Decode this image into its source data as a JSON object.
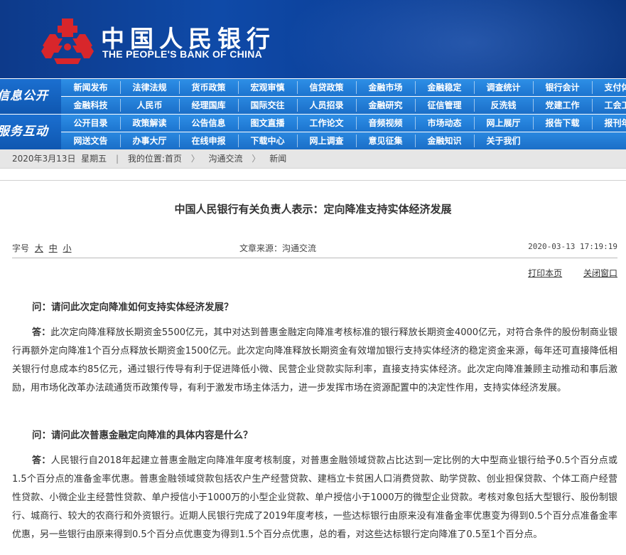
{
  "header": {
    "logo_cn": "中国人民银行",
    "logo_en": "THE PEOPLE'S BANK OF CHINA",
    "brand_color": "#0f4aa8",
    "logo_color": "#d8262b"
  },
  "nav": {
    "group1_tag": "信息公开",
    "group2_tag": "服务互动",
    "group1_row1": [
      "新闻发布",
      "法律法规",
      "货币政策",
      "宏观审慎",
      "信贷政策",
      "金融市场",
      "金融稳定",
      "调查统计",
      "银行会计",
      "支付体系"
    ],
    "group1_row2": [
      "金融科技",
      "人民币",
      "经理国库",
      "国际交往",
      "人员招录",
      "金融研究",
      "征信管理",
      "反洗钱",
      "党建工作",
      "工会工作"
    ],
    "group2_row1": [
      "公开目录",
      "政策解读",
      "公告信息",
      "图文直播",
      "工作论文",
      "音频视频",
      "市场动态",
      "网上展厅",
      "报告下载",
      "报刊年鉴"
    ],
    "group2_row2": [
      "网送文告",
      "办事大厅",
      "在线申报",
      "下载中心",
      "网上调查",
      "意见征集",
      "金融知识",
      "关于我们"
    ]
  },
  "breadcrumb": {
    "date": "2020年3月13日",
    "weekday": "星期五",
    "location_label": "我的位置:首页",
    "level2": "沟通交流",
    "level3": "新闻",
    "sep": "〉"
  },
  "article": {
    "title": "中国人民银行有关负责人表示：定向降准支持实体经济发展",
    "font_size_label": "字号",
    "font_large": "大",
    "font_medium": "中",
    "font_small": "小",
    "source": "文章来源：沟通交流",
    "datetime": "2020-03-13 17:19:19",
    "print_link": "打印本页",
    "close_link": "关闭窗口",
    "q1": "问：请问此次定向降准如何支持实体经济发展？",
    "a1_label": "答：",
    "a1": "此次定向降准释放长期资金5500亿元，其中对达到普惠金融定向降准考核标准的银行释放长期资金4000亿元，对符合条件的股份制商业银行再额外定向降准1个百分点释放长期资金1500亿元。此次定向降准释放长期资金有效增加银行支持实体经济的稳定资金来源，每年还可直接降低相关银行付息成本约85亿元，通过银行传导有利于促进降低小微、民营企业贷款实际利率，直接支持实体经济。此次定向降准兼顾主动推动和事后激励，用市场化改革办法疏通货币政策传导，有利于激发市场主体活力，进一步发挥市场在资源配置中的决定性作用，支持实体经济发展。",
    "q2": "问：请问此次普惠金融定向降准的具体内容是什么？",
    "a2_label": "答：",
    "a2": "人民银行自2018年起建立普惠金融定向降准年度考核制度，对普惠金融领域贷款占比达到一定比例的大中型商业银行给予0.5个百分点或1.5个百分点的准备金率优惠。普惠金融领域贷款包括农户生产经营贷款、建档立卡贫困人口消费贷款、助学贷款、创业担保贷款、个体工商户经营性贷款、小微企业主经营性贷款、单户授信小于1000万的小型企业贷款、单户授信小于1000万的微型企业贷款。考核对象包括大型银行、股份制银行、城商行、较大的农商行和外资银行。近期人民银行完成了2019年度考核，一些达标银行由原来没有准备金率优惠变为得到0.5个百分点准备金率优惠，另一些银行由原来得到0.5个百分点优惠变为得到1.5个百分点优惠，总的看，对这些达标银行定向降准了0.5至1个百分点。"
  }
}
